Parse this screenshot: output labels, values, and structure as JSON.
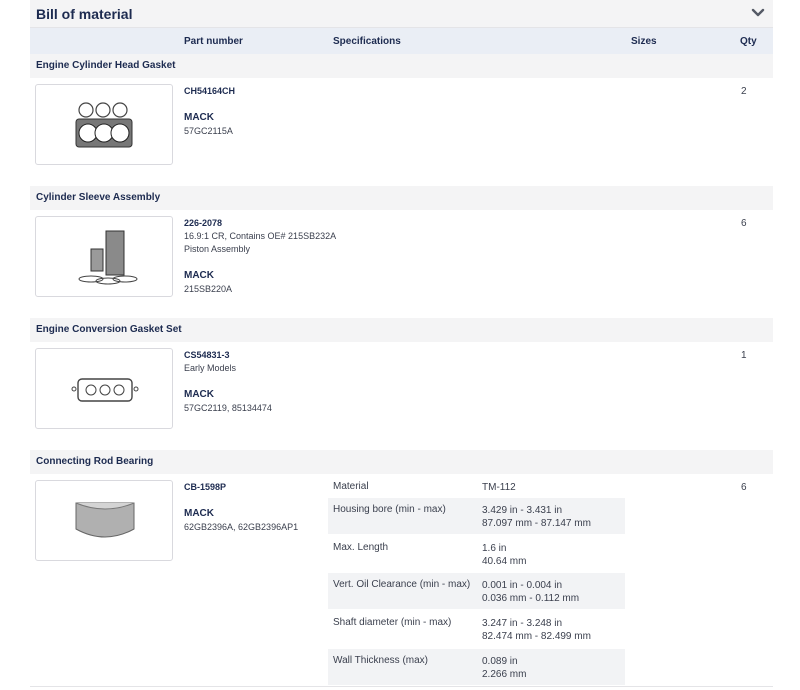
{
  "panel": {
    "title": "Bill of material",
    "toggle_icon": "chevron-down-icon"
  },
  "columns": {
    "part_number": "Part number",
    "specifications": "Specifications",
    "sizes": "Sizes",
    "qty": "Qty"
  },
  "items": [
    {
      "category": "Engine Cylinder Head Gasket",
      "part_number": "CH54164CH",
      "notes": [],
      "brand": "MACK",
      "oe": "57GC2115A",
      "qty": "2",
      "image_icon": "head-gasket-image"
    },
    {
      "category": "Cylinder Sleeve Assembly",
      "part_number": "226-2078",
      "notes": [
        "16.9:1 CR, Contains OE# 215SB232A",
        "Piston Assembly"
      ],
      "brand": "MACK",
      "oe": "215SB220A",
      "qty": "6",
      "image_icon": "sleeve-assembly-image"
    },
    {
      "category": "Engine Conversion Gasket Set",
      "part_number": "CS54831-3",
      "notes": [
        "Early Models"
      ],
      "brand": "MACK",
      "oe": "57GC2119, 85134474",
      "qty": "1",
      "image_icon": "gasket-set-image"
    },
    {
      "category": "Connecting Rod Bearing",
      "part_number": "CB-1598P",
      "notes": [],
      "brand": "MACK",
      "oe": "62GB2396A, 62GB2396AP1",
      "qty": "6",
      "image_icon": "rod-bearing-image",
      "specs": [
        {
          "label": "Material",
          "value": [
            "TM-112"
          ]
        },
        {
          "label": "Housing bore (min - max)",
          "value": [
            "3.429 in - 3.431 in",
            "87.097 mm - 87.147 mm"
          ]
        },
        {
          "label": "Max. Length",
          "value": [
            "1.6 in",
            "40.64 mm"
          ]
        },
        {
          "label": "Vert. Oil Clearance (min - max)",
          "value": [
            "0.001 in - 0.004 in",
            "0.036 mm - 0.112 mm"
          ]
        },
        {
          "label": "Shaft diameter (min - max)",
          "value": [
            "3.247 in - 3.248 in",
            "82.474 mm - 82.499 mm"
          ]
        },
        {
          "label": "Wall Thickness (max)",
          "value": [
            "0.089 in",
            "2.266 mm"
          ]
        }
      ]
    }
  ]
}
